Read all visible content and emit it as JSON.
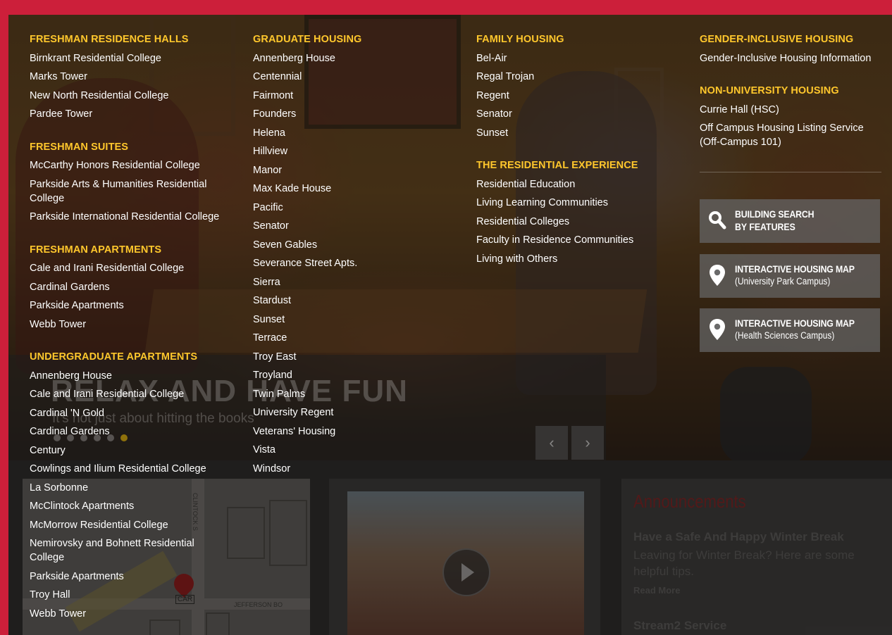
{
  "slider": {
    "title": "RELAX AND HAVE FUN",
    "subtitle": "It's not just about hitting the books",
    "prev_icon": "chevron-left-icon",
    "next_icon": "chevron-right-icon",
    "dot_count": 6,
    "active_dot": 6
  },
  "menu": {
    "freshman_halls": {
      "heading": "FRESHMAN RESIDENCE HALLS",
      "items": [
        "Birnkrant Residential College",
        "Marks Tower",
        "New North Residential College",
        "Pardee Tower"
      ]
    },
    "freshman_suites": {
      "heading": "FRESHMAN SUITES",
      "items": [
        "McCarthy Honors Residential College",
        "Parkside Arts & Humanities Residential College",
        "Parkside International Residential College"
      ]
    },
    "freshman_apartments": {
      "heading": "FRESHMAN APARTMENTS",
      "items": [
        "Cale and Irani Residential College",
        "Cardinal Gardens",
        "Parkside Apartments",
        "Webb Tower"
      ]
    },
    "undergraduate_apartments": {
      "heading": "UNDERGRADUATE APARTMENTS",
      "items": [
        "Annenberg House",
        "Cale and Irani Residential College",
        "Cardinal 'N Gold",
        "Cardinal Gardens",
        "Century",
        "Cowlings and Ilium Residential College",
        "La Sorbonne",
        "McClintock Apartments",
        "McMorrow Residential College",
        "Nemirovsky and Bohnett Residential College",
        "Parkside Apartments",
        "Troy Hall",
        "Webb Tower"
      ]
    },
    "graduate_housing": {
      "heading": "GRADUATE HOUSING",
      "items": [
        "Annenberg House",
        "Centennial",
        "Fairmont",
        "Founders",
        "Helena",
        "Hillview",
        "Manor",
        "Max Kade House",
        "Pacific",
        "Senator",
        "Seven Gables",
        "Severance Street Apts.",
        "Sierra",
        "Stardust",
        "Sunset",
        "Terrace",
        "Troy East",
        "Troyland",
        "Twin Palms",
        "University Regent",
        "Veterans' Housing",
        "Vista",
        "Windsor"
      ]
    },
    "family_housing": {
      "heading": "FAMILY HOUSING",
      "items": [
        "Bel-Air",
        "Regal Trojan",
        "Regent",
        "Senator",
        "Sunset"
      ]
    },
    "residential_experience": {
      "heading": "THE RESIDENTIAL EXPERIENCE",
      "items": [
        "Residential Education",
        "Living Learning Communities",
        "Residential Colleges",
        "Faculty in Residence Communities",
        "Living with Others"
      ]
    },
    "gender_inclusive": {
      "heading": "GENDER-INCLUSIVE HOUSING",
      "items": [
        "Gender-Inclusive Housing Information"
      ]
    },
    "non_university": {
      "heading": "NON-UNIVERSITY HOUSING",
      "items": [
        "Currie Hall (HSC)",
        "Off Campus Housing Listing Service (Off-Campus 101)"
      ]
    }
  },
  "tools": [
    {
      "line1": "BUILDING SEARCH",
      "line2": "BY FEATURES",
      "icon": "search-icon"
    },
    {
      "line1": "INTERACTIVE HOUSING MAP",
      "line2": "(University Park Campus)",
      "icon": "map-pin-icon"
    },
    {
      "line1": "INTERACTIVE HOUSING MAP",
      "line2": "(Health Sciences Campus)",
      "icon": "map-pin-icon"
    }
  ],
  "map": {
    "street_label": "CLINTOCK S",
    "street2_label": "JEFFERSON BO",
    "marker_label": "CAR",
    "marker_icon": "map-marker-icon"
  },
  "video": {
    "play_icon": "play-icon"
  },
  "announcements": {
    "title": "Announcements",
    "items": [
      {
        "heading": "Have a Safe And Happy Winter Break",
        "text": "Leaving for Winter Break? Here are some helpful tips.",
        "link": "Read More"
      },
      {
        "heading": "Stream2 Service"
      }
    ]
  },
  "colors": {
    "accent": "#ffc72c",
    "frame": "#cc1f3a"
  }
}
